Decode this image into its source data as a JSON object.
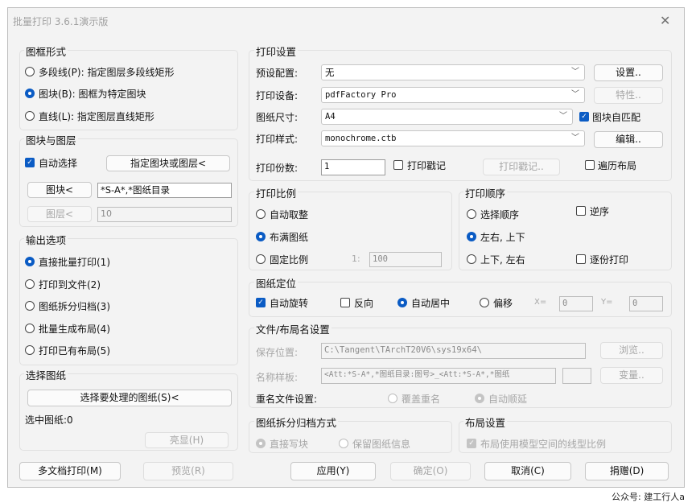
{
  "window": {
    "title": "批量打印 3.6.1演示版",
    "close": "✕"
  },
  "frame_form": {
    "title": "图框形式",
    "options": [
      "多段线(P): 指定图层多段线矩形",
      "图块(B): 图框为特定图块",
      "直线(L): 指定图层直线矩形"
    ],
    "selected": 1
  },
  "block_layer": {
    "title": "图块与图层",
    "auto_select": "自动选择",
    "specify_button": "指定图块或图层<",
    "block_button": "图块<",
    "block_value": "*S-A*,*图纸目录",
    "layer_button": "图层<",
    "layer_value": "10"
  },
  "output": {
    "title": "输出选项",
    "options": [
      "直接批量打印(1)",
      "打印到文件(2)",
      "图纸拆分归档(3)",
      "批量生成布局(4)",
      "打印已有布局(5)"
    ],
    "selected": 0
  },
  "select_drawings": {
    "title": "选择图纸",
    "button": "选择要处理的图纸(S)<",
    "status": "选中图纸:0",
    "highlight_button": "亮显(H)"
  },
  "print_settings": {
    "title": "打印设置",
    "preset_label": "预设配置:",
    "preset_value": "无",
    "settings_button": "设置..",
    "device_label": "打印设备:",
    "device_value": "pdfFactory Pro",
    "props_button": "特性..",
    "paper_label": "图纸尺寸:",
    "paper_value": "A4",
    "block_match": "图块自匹配",
    "style_label": "打印样式:",
    "style_value": "monochrome.ctb",
    "edit_button": "编辑..",
    "copies_label": "打印份数:",
    "copies_value": "1",
    "stamp_check": "打印戳记",
    "stamp_button": "打印戳记..",
    "traverse_check": "遍历布局"
  },
  "scale": {
    "title": "打印比例",
    "options": [
      "自动取整",
      "布满图纸",
      "固定比例"
    ],
    "selected": 1,
    "ratio_prefix": "1:",
    "ratio_value": "100"
  },
  "order": {
    "title": "打印顺序",
    "options": [
      "选择顺序",
      "左右, 上下",
      "上下, 左右"
    ],
    "selected": 1,
    "reverse": "逆序",
    "per_copy": "逐份打印"
  },
  "position": {
    "title": "图纸定位",
    "auto_rotate": "自动旋转",
    "reverse": "反向",
    "auto_center": "自动居中",
    "offset": "偏移",
    "x_label": "X=",
    "x_value": "0",
    "y_label": "Y=",
    "y_value": "0"
  },
  "file_layout": {
    "title": "文件/布局名设置",
    "save_label": "保存位置:",
    "save_value": "C:\\Tangent\\TArchT20V6\\sys19x64\\",
    "browse_button": "浏览..",
    "name_label": "名称样板:",
    "name_value": "<Att:*S-A*,*图纸目录:图号>_<Att:*S-A*,*图纸",
    "var_button": "变量..",
    "rename_label": "重名文件设置:",
    "overwrite": "覆盖重名",
    "auto_increment": "自动顺延"
  },
  "split": {
    "title": "图纸拆分归档方式",
    "options": [
      "直接写块",
      "保留图纸信息"
    ],
    "selected": 0
  },
  "layout_settings": {
    "title": "布局设置",
    "model_scale": "布局使用模型空间的线型比例"
  },
  "footer": {
    "multi_doc": "多文档打印(M)",
    "preview": "预览(R)",
    "apply": "应用(Y)",
    "ok": "确定(O)",
    "cancel": "取消(C)",
    "donate": "捐赠(D)"
  },
  "watermark": "公众号: 建工行人a",
  "colors": {
    "accent": "#0a5bc4",
    "disabled": "#a6a6a6"
  }
}
